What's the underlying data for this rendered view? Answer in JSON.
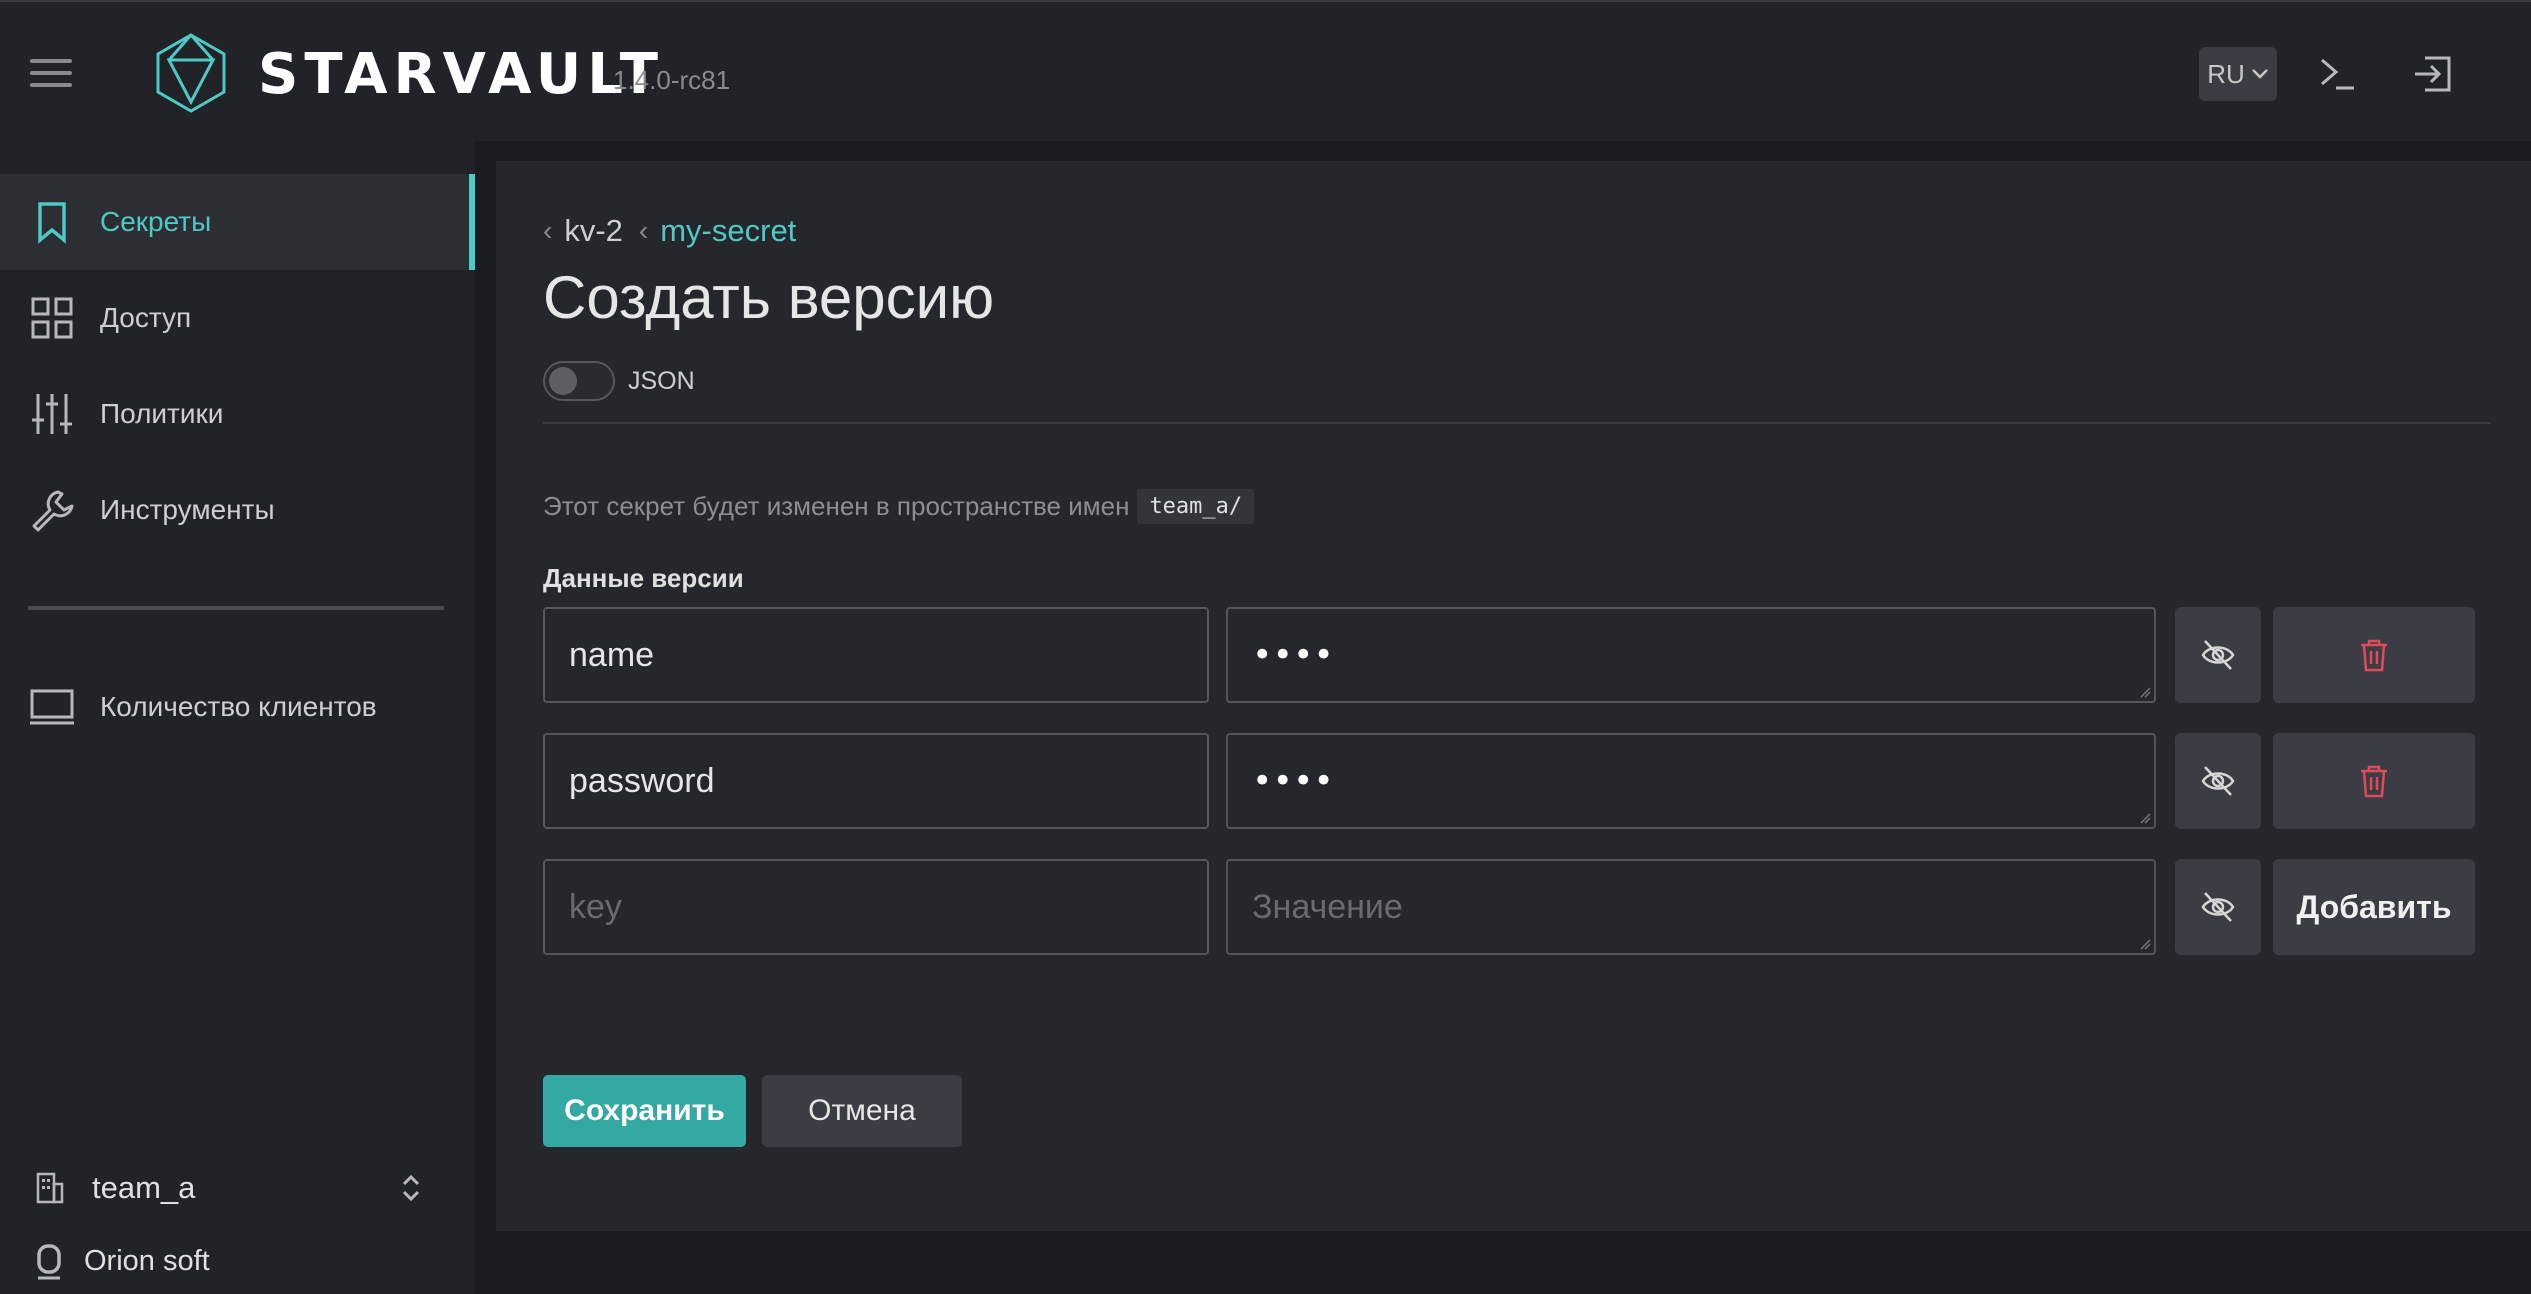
{
  "header": {
    "brand": "STARVAULT",
    "version": "1.4.0-rc81",
    "lang": "RU",
    "accent": "#4ec9c4"
  },
  "sidebar": {
    "items": [
      {
        "label": "Секреты",
        "icon": "bookmark-icon",
        "active": true
      },
      {
        "label": "Доступ",
        "icon": "grid-icon"
      },
      {
        "label": "Политики",
        "icon": "sliders-icon"
      },
      {
        "label": "Инструменты",
        "icon": "wrench-icon"
      },
      {
        "label": "Количество клиентов",
        "icon": "monitor-icon"
      }
    ],
    "tenant": "team_a",
    "org": "Orion soft"
  },
  "main": {
    "breadcrumbs": [
      "kv-2",
      "my-secret"
    ],
    "title": "Создать версию",
    "json_toggle_label": "JSON",
    "json_toggle_on": false,
    "namespace_note": "Этот секрет будет изменен в пространстве имен",
    "namespace": "team_a/",
    "section_label": "Данные версии",
    "rows": [
      {
        "key": "name",
        "value": "••••"
      },
      {
        "key": "password",
        "value": "••••"
      }
    ],
    "new_row": {
      "key_placeholder": "key",
      "value_placeholder": "Значение",
      "add_label": "Добавить"
    },
    "save_label": "Сохранить",
    "cancel_label": "Отмена"
  }
}
